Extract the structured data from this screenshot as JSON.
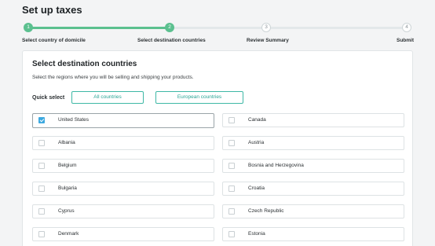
{
  "page": {
    "title": "Set up taxes"
  },
  "stepper": {
    "steps": [
      {
        "number": "1",
        "label": "Select country of domicile",
        "status": "done"
      },
      {
        "number": "2",
        "label": "Select destination countries",
        "status": "current"
      },
      {
        "number": "3",
        "label": "Review Summary",
        "status": "todo"
      },
      {
        "number": "4",
        "label": "Submit",
        "status": "todo"
      }
    ],
    "colors": {
      "done": "#5bc08f",
      "todo": "#e3e8ea"
    }
  },
  "card": {
    "title": "Select destination countries",
    "description": "Select the regions where you will be selling and shipping your products.",
    "quick_select": {
      "label": "Quick select",
      "buttons": [
        "All countries",
        "European countries"
      ]
    },
    "countries": [
      {
        "name": "United States",
        "checked": true,
        "flag": "us-flag-icon"
      },
      {
        "name": "Canada",
        "checked": false,
        "flag": "ca-flag-icon"
      },
      {
        "name": "Albania",
        "checked": false,
        "flag": "al-flag-icon"
      },
      {
        "name": "Austria",
        "checked": false,
        "flag": "at-flag-icon"
      },
      {
        "name": "Belgium",
        "checked": false,
        "flag": "be-flag-icon"
      },
      {
        "name": "Bosnia and Herzegovina",
        "checked": false,
        "flag": "ba-flag-icon"
      },
      {
        "name": "Bulgaria",
        "checked": false,
        "flag": "bg-flag-icon"
      },
      {
        "name": "Croatia",
        "checked": false,
        "flag": "hr-flag-icon"
      },
      {
        "name": "Cyprus",
        "checked": false,
        "flag": "cy-flag-icon"
      },
      {
        "name": "Czech Republic",
        "checked": false,
        "flag": "cz-flag-icon"
      },
      {
        "name": "Denmark",
        "checked": false,
        "flag": "dk-flag-icon"
      },
      {
        "name": "Estonia",
        "checked": false,
        "flag": "ee-flag-icon"
      }
    ]
  }
}
